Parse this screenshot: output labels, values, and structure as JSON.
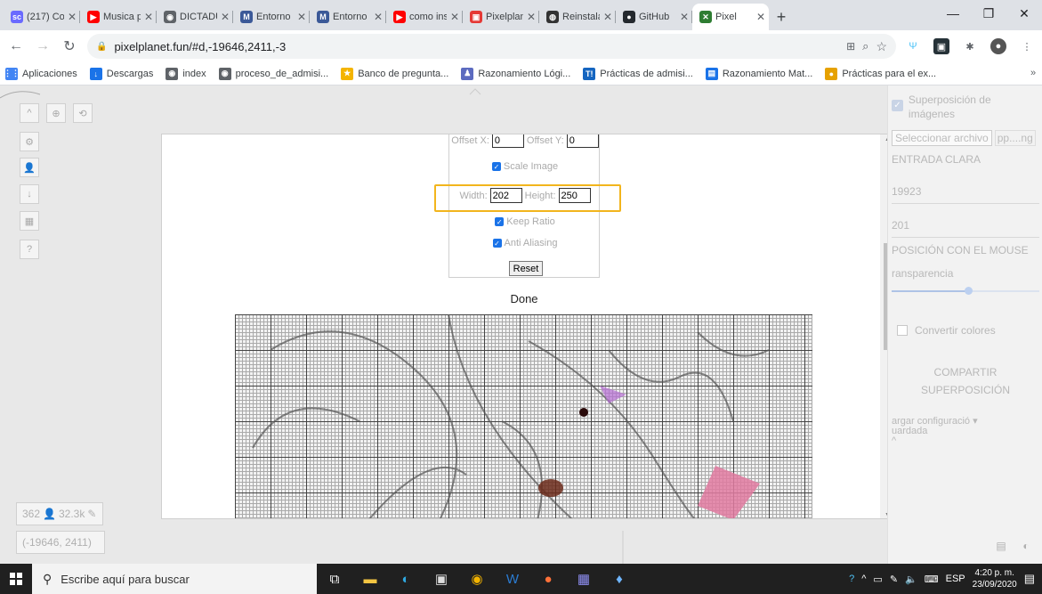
{
  "tabs": [
    {
      "title": "(217) Co",
      "color": "#6a6aff",
      "glyph": "sc"
    },
    {
      "title": "Musica p",
      "color": "#ff0000",
      "glyph": "▶"
    },
    {
      "title": "DICTADU",
      "color": "#5f6368",
      "glyph": "◉"
    },
    {
      "title": "Entorno",
      "color": "#3b5998",
      "glyph": "M"
    },
    {
      "title": "Entorno",
      "color": "#3b5998",
      "glyph": "M"
    },
    {
      "title": "como ins",
      "color": "#ff0000",
      "glyph": "▶"
    },
    {
      "title": "Pixelplan",
      "color": "#e53935",
      "glyph": "▣"
    },
    {
      "title": "Reinstala",
      "color": "#333",
      "glyph": "◍"
    },
    {
      "title": "GitHub",
      "color": "#24292e",
      "glyph": "●"
    },
    {
      "title": "Pixel",
      "color": "#2e7d32",
      "glyph": "✕",
      "active": true
    }
  ],
  "window": {
    "minimize": "—",
    "maximize": "❐",
    "close": "✕",
    "new_tab": "+"
  },
  "address_bar": {
    "url": "pixelplanet.fun/#d,-19646,2411,-3",
    "lock": "🔒"
  },
  "bookmarks": [
    {
      "label": "Aplicaciones",
      "color": "#4285f4",
      "glyph": "⋮⋮"
    },
    {
      "label": "Descargas",
      "color": "#1a73e8",
      "glyph": "↓"
    },
    {
      "label": "index",
      "color": "#5f6368",
      "glyph": "◉"
    },
    {
      "label": "proceso_de_admisi...",
      "color": "#5f6368",
      "glyph": "◉"
    },
    {
      "label": "Banco de pregunta...",
      "color": "#f4b400",
      "glyph": "★"
    },
    {
      "label": "Razonamiento Lógi...",
      "color": "#5c6bc0",
      "glyph": "♟"
    },
    {
      "label": "Prácticas de admisi...",
      "color": "#1565c0",
      "glyph": "T!"
    },
    {
      "label": "Razonamiento Mat...",
      "color": "#1a73e8",
      "glyph": "▤"
    },
    {
      "label": "Prácticas para el ex...",
      "color": "#e6a100",
      "glyph": "●"
    }
  ],
  "left_toolbar": {
    "top_row": [
      "^",
      "⊕",
      "⟲"
    ],
    "buttons": [
      "⚙",
      "👤",
      "↓",
      "▦",
      "?"
    ],
    "online_count": "362",
    "pixel_count": "32.3k",
    "coordinates": "(-19646, 2411)"
  },
  "modal": {
    "offset_x_label": "Offset X:",
    "offset_x_value": "0",
    "offset_y_label": "Offset Y:",
    "offset_y_value": "0",
    "scale_image_label": "Scale Image",
    "width_label": "Width:",
    "width_value": "202",
    "height_label": "Height:",
    "height_value": "250",
    "keep_ratio_label": "Keep Ratio",
    "anti_aliasing_label": "Anti Aliasing",
    "reset_label": "Reset",
    "status": "Done"
  },
  "right_panel": {
    "overlay_title": "Superposición de imágenes",
    "select_file": "Seleccionar archivo",
    "file_hint": "pp....ng",
    "entrada_clara": "ENTRADA CLARA",
    "x_value": "19923",
    "y_value": "201",
    "mouse_position": "POSICIÓN CON EL MOUSE",
    "transparency": "ransparencia",
    "convert_colors": "Convertir colores",
    "share_1": "COMPARTIR",
    "share_2": "SUPERPOSICIÓN",
    "load_config": "argar configuració",
    "load_config_2": "uardada"
  },
  "taskbar": {
    "search_placeholder": "Escribe aquí para buscar",
    "language": "ESP",
    "time": "4:20 p. m.",
    "date": "23/09/2020"
  }
}
